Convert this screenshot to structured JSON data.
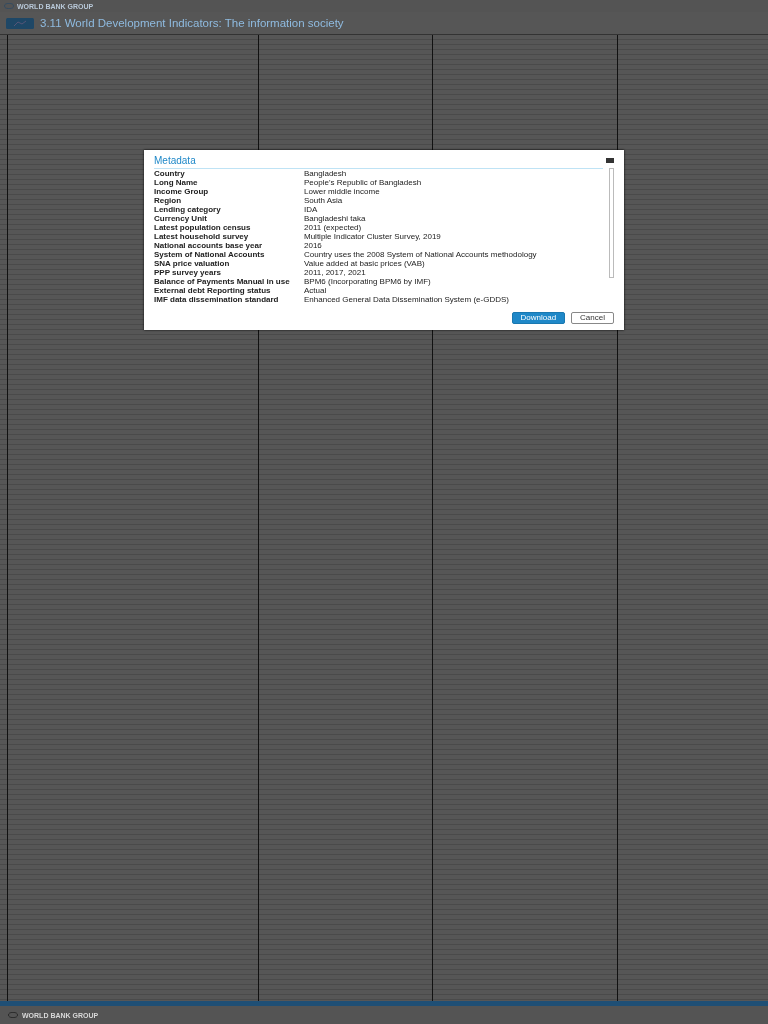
{
  "page": {
    "brand": "WORLD BANK GROUP",
    "title": "3.11 World Development Indicators: The information society",
    "footer_brand": "WORLD BANK GROUP"
  },
  "dialog": {
    "title": "Metadata",
    "rows": [
      {
        "label": "Country",
        "value": "Bangladesh"
      },
      {
        "label": "Long Name",
        "value": "People's Republic of Bangladesh"
      },
      {
        "label": "Income Group",
        "value": "Lower middle income"
      },
      {
        "label": "Region",
        "value": "South Asia"
      },
      {
        "label": "Lending category",
        "value": "IDA"
      },
      {
        "label": "Currency Unit",
        "value": "Bangladeshi taka"
      },
      {
        "label": "Latest population census",
        "value": "2011 (expected)"
      },
      {
        "label": "Latest household survey",
        "value": "Multiple Indicator Cluster Survey, 2019"
      },
      {
        "label": "National accounts base year",
        "value": "2016"
      },
      {
        "label": "System of National Accounts",
        "value": "Country uses the 2008 System of National Accounts methodology"
      },
      {
        "label": "SNA price valuation",
        "value": "Value added at basic prices (VAB)"
      },
      {
        "label": "PPP survey years",
        "value": "2011, 2017, 2021"
      },
      {
        "label": "Balance of Payments Manual in use",
        "value": "BPM6 (Incorporating BPM6 by IMF)"
      },
      {
        "label": "External debt Reporting status",
        "value": "Actual"
      },
      {
        "label": "IMF data dissemination standard",
        "value": "Enhanced General Data Dissemination System (e-GDDS)"
      }
    ],
    "buttons": [
      {
        "label": "Download",
        "kind": "primary"
      },
      {
        "label": "Cancel",
        "kind": "secondary"
      }
    ]
  }
}
